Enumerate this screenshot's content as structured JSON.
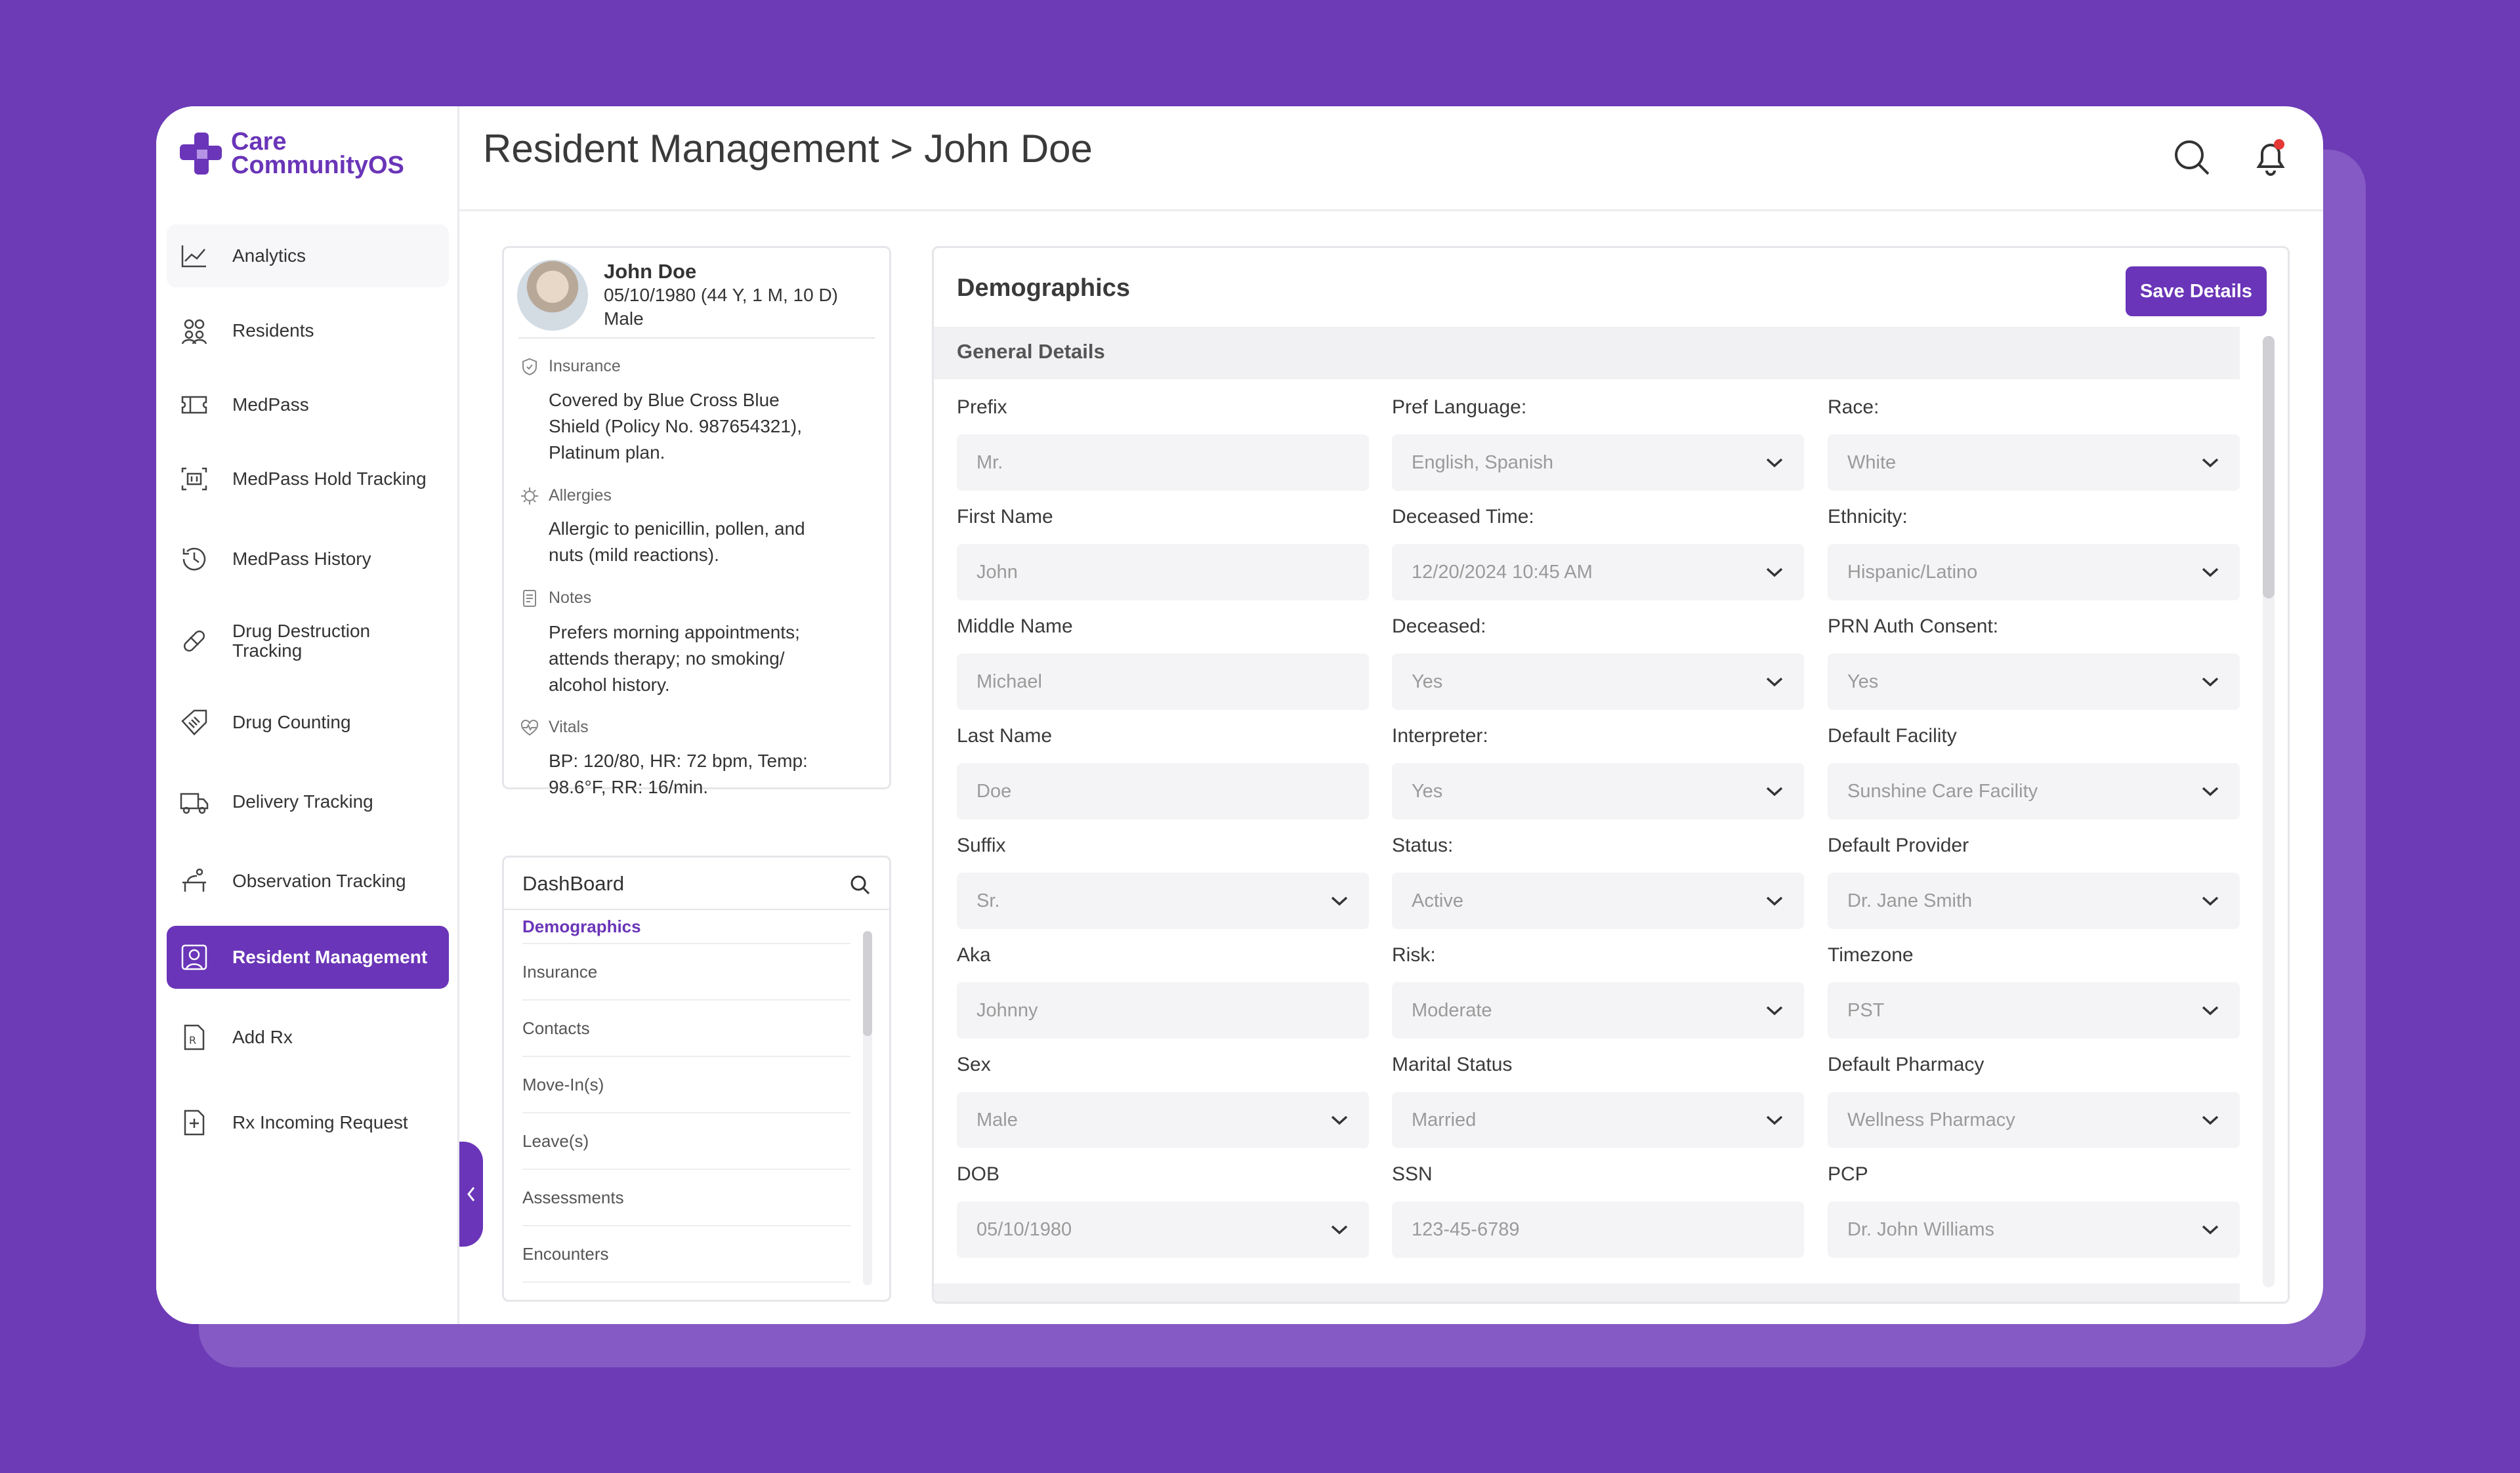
{
  "app": {
    "logo_line1": "Care",
    "logo_line2": "CommunityOS"
  },
  "sidebar": {
    "items": [
      {
        "label": "Analytics",
        "icon": "chart-line-icon"
      },
      {
        "label": "Residents",
        "icon": "users-icon"
      },
      {
        "label": "MedPass",
        "icon": "ticket-icon"
      },
      {
        "label": "MedPass Hold Tracking",
        "icon": "hold-icon"
      },
      {
        "label": "MedPass History",
        "icon": "history-icon"
      },
      {
        "label": "Drug Destruction Tracking",
        "icon": "pill-icon"
      },
      {
        "label": "Drug Counting",
        "icon": "tag-icon"
      },
      {
        "label": "Delivery Tracking",
        "icon": "truck-icon"
      },
      {
        "label": "Observation Tracking",
        "icon": "observation-icon"
      },
      {
        "label": "Resident Management",
        "icon": "person-frame-icon"
      },
      {
        "label": "Add Rx",
        "icon": "rx-file-icon"
      },
      {
        "label": "Rx Incoming Request",
        "icon": "file-plus-icon"
      }
    ]
  },
  "header": {
    "title": "Resident Management > John Doe"
  },
  "profile": {
    "name": "John Doe",
    "dob_age": "05/10/1980 (44 Y, 1 M, 10 D)",
    "sex": "Male",
    "insurance_title": "Insurance",
    "insurance_lines": [
      "Covered by Blue Cross Blue",
      "Shield (Policy No. 987654321),",
      "Platinum plan."
    ],
    "allergies_title": "Allergies",
    "allergies_lines": [
      "Allergic to penicillin, pollen, and",
      "nuts (mild reactions)."
    ],
    "notes_title": "Notes",
    "notes_lines": [
      "Prefers morning appointments;",
      "attends therapy; no smoking/",
      "alcohol history."
    ],
    "vitals_title": "Vitals",
    "vitals_lines": [
      "BP: 120/80, HR: 72 bpm, Temp:",
      "98.6°F, RR: 16/min."
    ]
  },
  "dashboard": {
    "title": "DashBoard",
    "items": [
      "Demographics",
      "Insurance",
      "Contacts",
      "Move-In(s)",
      "Leave(s)",
      "Assessments",
      "Encounters"
    ]
  },
  "demographics": {
    "title": "Demographics",
    "save_label": "Save Details",
    "section": "General Details",
    "columns": [
      [
        {
          "label": "Prefix",
          "value": "Mr.",
          "dropdown": false
        },
        {
          "label": "First Name",
          "value": "John",
          "dropdown": false
        },
        {
          "label": "Middle Name",
          "value": "Michael",
          "dropdown": false
        },
        {
          "label": "Last Name",
          "value": "Doe",
          "dropdown": false
        },
        {
          "label": "Suffix",
          "value": "Sr.",
          "dropdown": true
        },
        {
          "label": "Aka",
          "value": "Johnny",
          "dropdown": false
        },
        {
          "label": "Sex",
          "value": "Male",
          "dropdown": true
        },
        {
          "label": "DOB",
          "value": "05/10/1980",
          "dropdown": true
        }
      ],
      [
        {
          "label": "Pref Language:",
          "value": "English, Spanish",
          "dropdown": true
        },
        {
          "label": "Deceased Time:",
          "value": "12/20/2024 10:45 AM",
          "dropdown": true
        },
        {
          "label": "Deceased:",
          "value": "Yes",
          "dropdown": true
        },
        {
          "label": "Interpreter:",
          "value": "Yes",
          "dropdown": true
        },
        {
          "label": "Status:",
          "value": "Active",
          "dropdown": true
        },
        {
          "label": "Risk:",
          "value": "Moderate",
          "dropdown": true
        },
        {
          "label": "Marital Status",
          "value": "Married",
          "dropdown": true
        },
        {
          "label": "SSN",
          "value": "123-45-6789",
          "dropdown": false
        }
      ],
      [
        {
          "label": "Race:",
          "value": "White",
          "dropdown": true
        },
        {
          "label": "Ethnicity:",
          "value": "Hispanic/Latino",
          "dropdown": true
        },
        {
          "label": "PRN Auth Consent:",
          "value": "Yes",
          "dropdown": true
        },
        {
          "label": "Default Facility",
          "value": "Sunshine Care Facility",
          "dropdown": true
        },
        {
          "label": "Default Provider",
          "value": "Dr. Jane Smith",
          "dropdown": true
        },
        {
          "label": "Timezone",
          "value": "PST",
          "dropdown": true
        },
        {
          "label": "Default Pharmacy",
          "value": "Wellness Pharmacy",
          "dropdown": true
        },
        {
          "label": "PCP",
          "value": "Dr. John Williams",
          "dropdown": true
        }
      ]
    ]
  },
  "colors": {
    "accent": "#6A35B8",
    "background": "#6C3BB5",
    "notification": "#E53935"
  }
}
